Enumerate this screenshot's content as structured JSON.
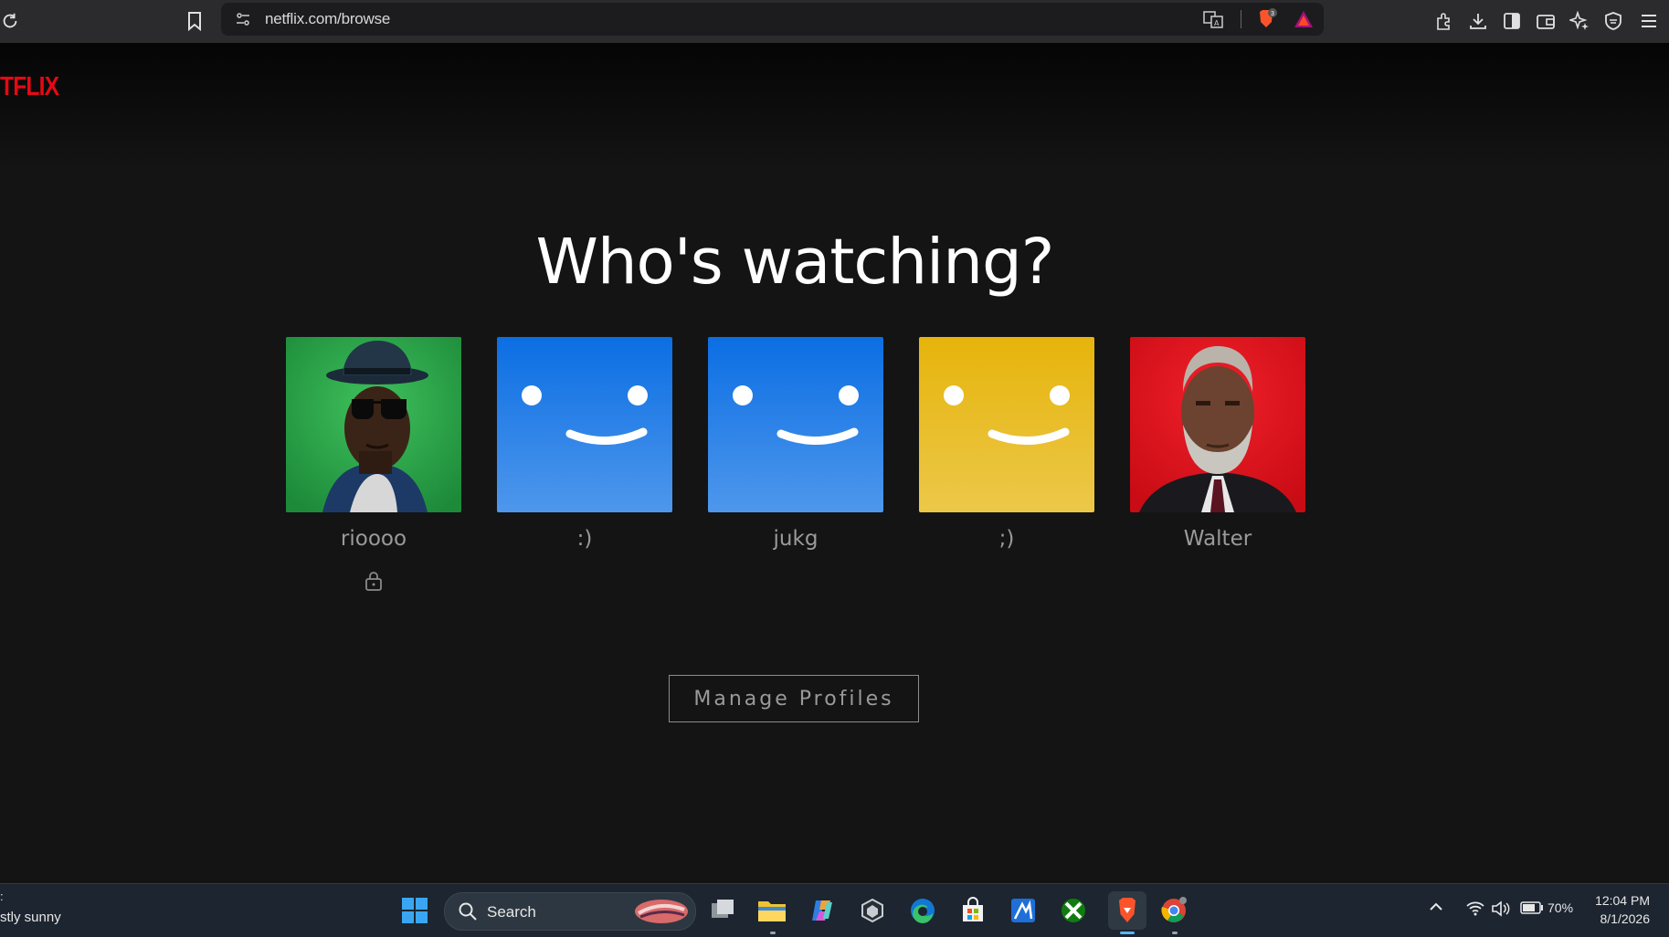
{
  "browser": {
    "url": "netflix.com/browse",
    "shields_badge": "3"
  },
  "page": {
    "logo": "TFLIX",
    "heading": "Who's watching?",
    "profiles": [
      {
        "name": "rioooo",
        "avatar": "photo-man-hat-green",
        "locked": true
      },
      {
        "name": ":)",
        "avatar": "smiley-blue",
        "locked": false
      },
      {
        "name": "jukg",
        "avatar": "smiley-blue",
        "locked": false
      },
      {
        "name": ";)",
        "avatar": "smiley-yellow",
        "locked": false
      },
      {
        "name": "Walter",
        "avatar": "photo-man-beard-red",
        "locked": false
      }
    ],
    "manage_button": "Manage Profiles"
  },
  "taskbar": {
    "weather_top": ":",
    "weather": "stly sunny",
    "search_label": "Search",
    "battery": "70%",
    "time": "12:04 PM",
    "date": "8/1/2026"
  },
  "colors": {
    "netflix_red": "#e50914",
    "profile_green": "#2aa84a",
    "profile_blue": "#0f6fe0",
    "profile_yellow": "#e9b714",
    "profile_red": "#e3101a"
  }
}
